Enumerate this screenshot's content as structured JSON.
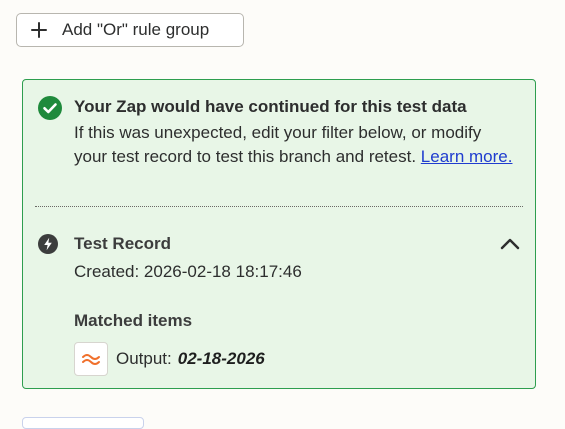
{
  "add_or_group": {
    "label": "Add \"Or\" rule group",
    "icon": "plus-icon"
  },
  "result_panel": {
    "title": "Your Zap would have continued for this test data",
    "description": "If this was unexpected, edit your filter below, or modify your test record to test this branch and retest.",
    "link_text": "Learn more.",
    "status_icon": "check-circle-icon",
    "colors": {
      "background": "#e8f6e7",
      "border": "#2e9e4f",
      "check": "#1f8a3c",
      "link": "#1f3ccf"
    }
  },
  "test_record": {
    "title": "Test Record",
    "created": "Created: 2026-02-18 18:17:46",
    "icon": "bolt-icon",
    "toggle_icon": "chevron-up-icon"
  },
  "matched_items": {
    "title": "Matched items",
    "items": [
      {
        "icon": "formatter-icon",
        "label": "Output:",
        "value": "02-18-2026"
      }
    ]
  }
}
